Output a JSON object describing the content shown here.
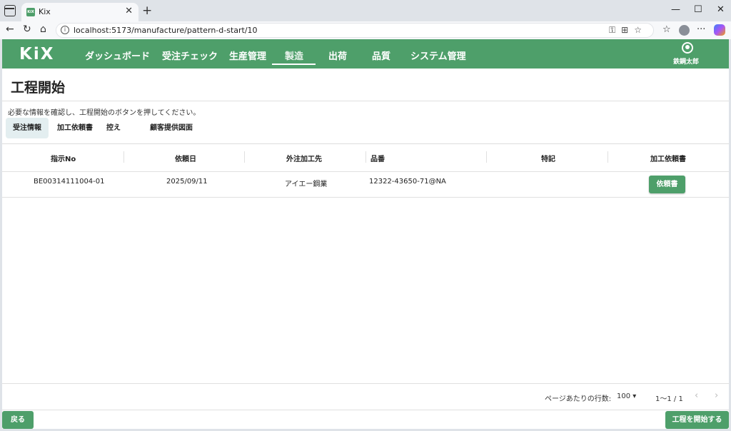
{
  "browser": {
    "tab_title": "Kix",
    "favicon_text": "KiX",
    "url": "localhost:5173/manufacture/pattern-d-start/10"
  },
  "app": {
    "logo": "KiX",
    "nav": [
      "ダッシュボード",
      "受注チェック",
      "生産管理",
      "製造",
      "出荷",
      "品質",
      "システム管理"
    ],
    "active_nav": "製造",
    "user_name": "鉄鋼太郎",
    "accent_color": "#4e9f6a"
  },
  "page": {
    "title": "工程開始",
    "instruction": "必要な情報を確認し、工程開始のボタンを押してください。",
    "subtabs": [
      "受注情報",
      "加工依頼書",
      "控え",
      "顧客提供図面"
    ],
    "active_subtab": "受注情報"
  },
  "table": {
    "headers": [
      "指示No",
      "依頼日",
      "外注加工先",
      "品番",
      "特記",
      "加工依頼書"
    ],
    "rows": [
      {
        "instruction_no": "BE00314111004-01",
        "request_date": "2025/09/11",
        "vendor": "アイエー鋼業",
        "part_no": "12322-43650-71@NA",
        "note": "",
        "button": "依頼書"
      }
    ]
  },
  "pagination": {
    "rows_per_page_label": "ページあたりの行数:",
    "rows_per_page": "100",
    "range": "1〜1 / 1"
  },
  "footer": {
    "back_label": "戻る",
    "start_label": "工程を開始する"
  }
}
